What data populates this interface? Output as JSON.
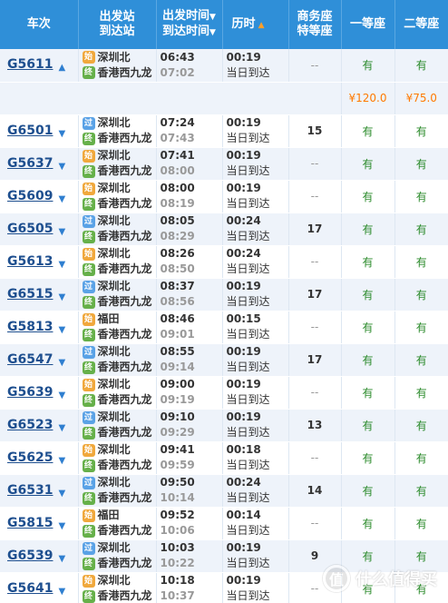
{
  "header": {
    "train": "车次",
    "station_top": "出发站",
    "station_bottom": "到达站",
    "time_top": "出发时间",
    "time_bottom": "到达时间",
    "duration": "历时",
    "business_top": "商务座",
    "business_bottom": "特等座",
    "first_class": "一等座",
    "second_class": "二等座"
  },
  "badges": {
    "through": "过",
    "start": "始",
    "end": "终"
  },
  "price_row": {
    "first": "¥120.0",
    "second": "¥75.0"
  },
  "trains": [
    {
      "no": "G5611",
      "from": "深圳北",
      "from_type": "start",
      "to": "香港西九龙",
      "dep": "06:43",
      "arr": "07:02",
      "dur": "00:19",
      "note": "当日到达",
      "business": "--",
      "first": "有",
      "second": "有",
      "expanded": true
    },
    {
      "no": "G6501",
      "from": "深圳北",
      "from_type": "through",
      "to": "香港西九龙",
      "dep": "07:24",
      "arr": "07:43",
      "dur": "00:19",
      "note": "当日到达",
      "business": "15",
      "first": "有",
      "second": "有"
    },
    {
      "no": "G5637",
      "from": "深圳北",
      "from_type": "start",
      "to": "香港西九龙",
      "dep": "07:41",
      "arr": "08:00",
      "dur": "00:19",
      "note": "当日到达",
      "business": "--",
      "first": "有",
      "second": "有"
    },
    {
      "no": "G5609",
      "from": "深圳北",
      "from_type": "start",
      "to": "香港西九龙",
      "dep": "08:00",
      "arr": "08:19",
      "dur": "00:19",
      "note": "当日到达",
      "business": "--",
      "first": "有",
      "second": "有"
    },
    {
      "no": "G6505",
      "from": "深圳北",
      "from_type": "through",
      "to": "香港西九龙",
      "dep": "08:05",
      "arr": "08:29",
      "dur": "00:24",
      "note": "当日到达",
      "business": "17",
      "first": "有",
      "second": "有"
    },
    {
      "no": "G5613",
      "from": "深圳北",
      "from_type": "start",
      "to": "香港西九龙",
      "dep": "08:26",
      "arr": "08:50",
      "dur": "00:24",
      "note": "当日到达",
      "business": "--",
      "first": "有",
      "second": "有"
    },
    {
      "no": "G6515",
      "from": "深圳北",
      "from_type": "through",
      "to": "香港西九龙",
      "dep": "08:37",
      "arr": "08:56",
      "dur": "00:19",
      "note": "当日到达",
      "business": "17",
      "first": "有",
      "second": "有"
    },
    {
      "no": "G5813",
      "from": "福田",
      "from_type": "start",
      "to": "香港西九龙",
      "dep": "08:46",
      "arr": "09:01",
      "dur": "00:15",
      "note": "当日到达",
      "business": "--",
      "first": "有",
      "second": "有"
    },
    {
      "no": "G6547",
      "from": "深圳北",
      "from_type": "through",
      "to": "香港西九龙",
      "dep": "08:55",
      "arr": "09:14",
      "dur": "00:19",
      "note": "当日到达",
      "business": "17",
      "first": "有",
      "second": "有"
    },
    {
      "no": "G5639",
      "from": "深圳北",
      "from_type": "start",
      "to": "香港西九龙",
      "dep": "09:00",
      "arr": "09:19",
      "dur": "00:19",
      "note": "当日到达",
      "business": "--",
      "first": "有",
      "second": "有"
    },
    {
      "no": "G6523",
      "from": "深圳北",
      "from_type": "through",
      "to": "香港西九龙",
      "dep": "09:10",
      "arr": "09:29",
      "dur": "00:19",
      "note": "当日到达",
      "business": "13",
      "first": "有",
      "second": "有"
    },
    {
      "no": "G5625",
      "from": "深圳北",
      "from_type": "start",
      "to": "香港西九龙",
      "dep": "09:41",
      "arr": "09:59",
      "dur": "00:18",
      "note": "当日到达",
      "business": "--",
      "first": "有",
      "second": "有"
    },
    {
      "no": "G6531",
      "from": "深圳北",
      "from_type": "through",
      "to": "香港西九龙",
      "dep": "09:50",
      "arr": "10:14",
      "dur": "00:24",
      "note": "当日到达",
      "business": "14",
      "first": "有",
      "second": "有"
    },
    {
      "no": "G5815",
      "from": "福田",
      "from_type": "start",
      "to": "香港西九龙",
      "dep": "09:52",
      "arr": "10:06",
      "dur": "00:14",
      "note": "当日到达",
      "business": "--",
      "first": "有",
      "second": "有"
    },
    {
      "no": "G6539",
      "from": "深圳北",
      "from_type": "through",
      "to": "香港西九龙",
      "dep": "10:03",
      "arr": "10:22",
      "dur": "00:19",
      "note": "当日到达",
      "business": "9",
      "first": "有",
      "second": "有"
    },
    {
      "no": "G5641",
      "from": "深圳北",
      "from_type": "start",
      "to": "香港西九龙",
      "dep": "10:18",
      "arr": "10:37",
      "dur": "00:19",
      "note": "当日到达",
      "business": "--",
      "first": "有",
      "second": "有"
    }
  ],
  "watermark": {
    "symbol": "值",
    "text": "什么值得买"
  }
}
